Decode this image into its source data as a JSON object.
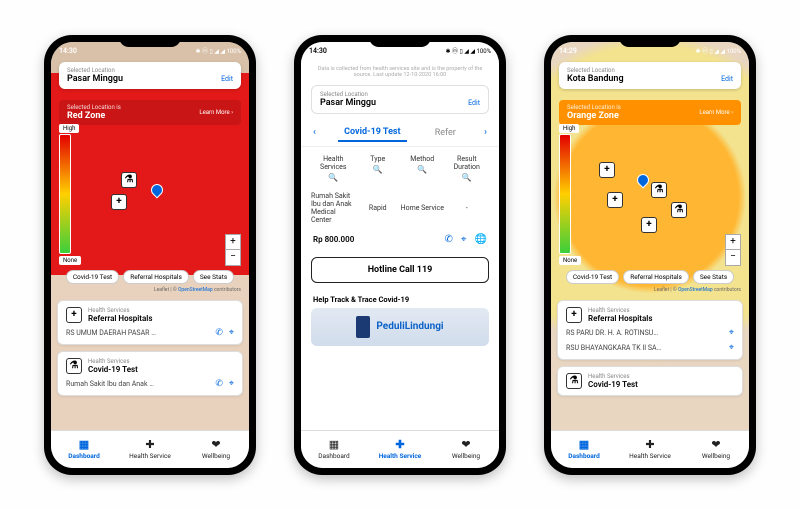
{
  "status": {
    "time": "14:30",
    "time_alt": "14:29",
    "icons": "◎ ⊕ ⓘ ✉ ⋯",
    "right": "✱ ⓜ ▯ ◢ ◢ 100%"
  },
  "loc": {
    "label": "Selected Location",
    "p1_name": "Pasar Minggu",
    "p3_name": "Kota Bandung",
    "edit": "Edit"
  },
  "zone": {
    "label": "Selected Location is",
    "p1": "Red Zone",
    "p3": "Orange Zone",
    "more": "Learn More ›"
  },
  "gradient": {
    "high": "High",
    "none": "None"
  },
  "pills": {
    "a": "Covid-19 Test",
    "b": "Referral Hospitals",
    "c": "See Stats"
  },
  "leaflet": {
    "prefix": "Leaflet | © ",
    "link": "OpenStreetMap",
    "suffix": " contributors"
  },
  "cards": {
    "meta": "Health Services",
    "referral": "Referral Hospitals",
    "covid": "Covid-19 Test",
    "p1_hosp": "RS UMUM DAERAH PASAR …",
    "p1_test": "Rumah Sakit Ibu dan Anak …",
    "p3_hosp1": "RS PARU DR. H. A. ROTINSU…",
    "p3_hosp2": "RSU BHAYANGKARA TK II SA…"
  },
  "nav": {
    "dash": "Dashboard",
    "health": "Health Service",
    "well": "Wellbeing"
  },
  "p2": {
    "disclaimer": "Data is collected from health services site and is the property of the source. Last update 12-10-2020 16:00",
    "tab_a": "Covid-19 Test",
    "tab_b": "Refer",
    "cols": {
      "a": "Health Services",
      "b": "Type",
      "c": "Method",
      "d": "Result Duration"
    },
    "row": {
      "name": "Rumah Sakit Ibu dan Anak Medical Center",
      "type": "Rapid",
      "method": "Home Service",
      "dur": "-"
    },
    "price": "Rp 800.000",
    "hotline": "Hotline Call 119",
    "track": "Help Track & Trace Covid-19",
    "peduli": "PeduliLindungi"
  }
}
